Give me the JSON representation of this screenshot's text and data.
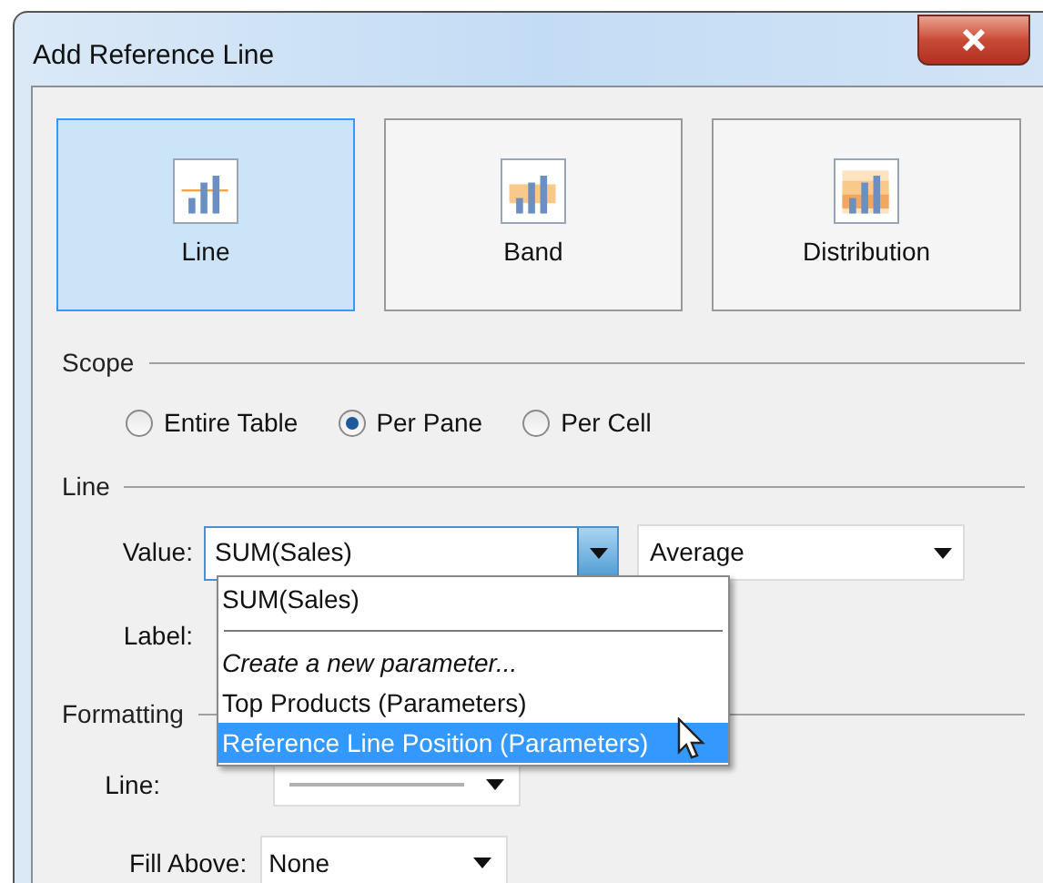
{
  "window": {
    "title": "Add Reference Line"
  },
  "types": [
    {
      "kind": "line",
      "label": "Line",
      "selected": true
    },
    {
      "kind": "band",
      "label": "Band",
      "selected": false
    },
    {
      "kind": "distribution",
      "label": "Distribution",
      "selected": false
    }
  ],
  "scope": {
    "heading": "Scope",
    "options": [
      {
        "label": "Entire Table",
        "selected": false
      },
      {
        "label": "Per Pane",
        "selected": true
      },
      {
        "label": "Per Cell",
        "selected": false
      }
    ]
  },
  "line": {
    "heading": "Line",
    "value_label": "Value:",
    "value": "SUM(Sales)",
    "aggregation": "Average",
    "label_label": "Label:",
    "dropdown": {
      "expanded": true,
      "items": [
        {
          "kind": "item",
          "label": "SUM(Sales)",
          "selected": false
        },
        {
          "kind": "separator"
        },
        {
          "kind": "action",
          "label": "Create a new parameter...",
          "selected": false
        },
        {
          "kind": "item",
          "label": "Top Products (Parameters)",
          "selected": false
        },
        {
          "kind": "item",
          "label": "Reference Line Position (Parameters)",
          "selected": true
        }
      ]
    }
  },
  "formatting": {
    "heading": "Formatting",
    "line_label": "Line:",
    "fill_above_label": "Fill Above:",
    "fill_above": "None"
  }
}
